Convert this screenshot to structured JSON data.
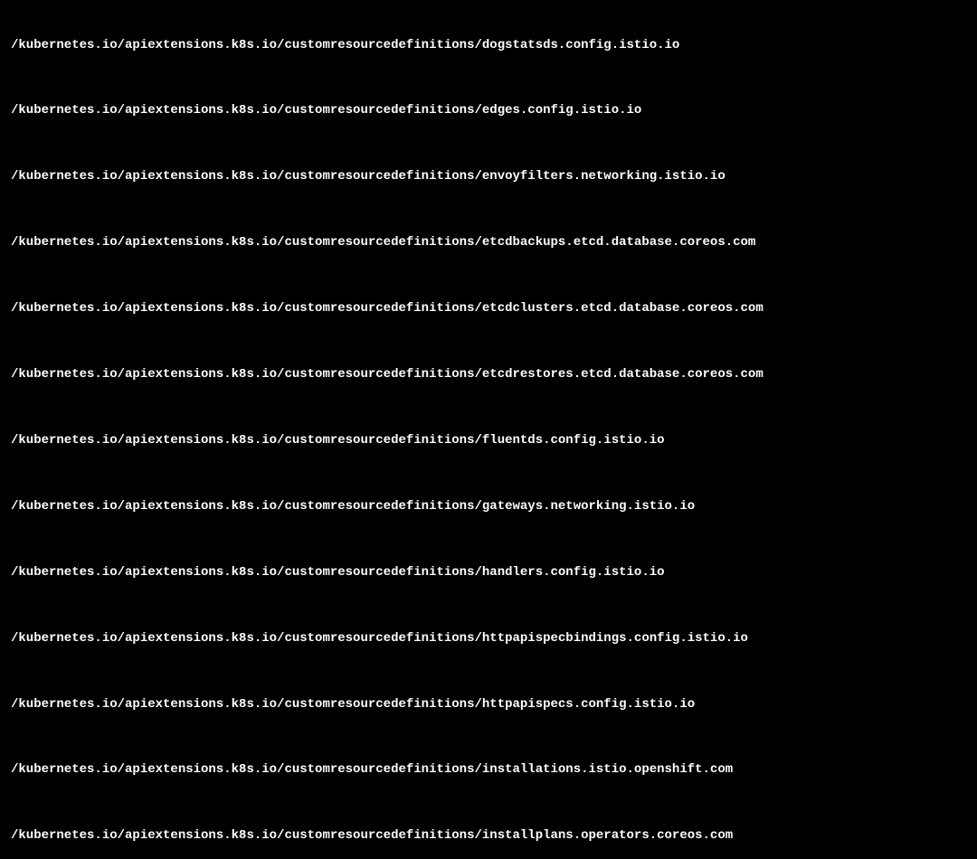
{
  "terminal": {
    "lines": [
      "/kubernetes.io/apiextensions.k8s.io/customresourcedefinitions/dogstatsds.config.istio.io",
      "/kubernetes.io/apiextensions.k8s.io/customresourcedefinitions/edges.config.istio.io",
      "/kubernetes.io/apiextensions.k8s.io/customresourcedefinitions/envoyfilters.networking.istio.io",
      "/kubernetes.io/apiextensions.k8s.io/customresourcedefinitions/etcdbackups.etcd.database.coreos.com",
      "/kubernetes.io/apiextensions.k8s.io/customresourcedefinitions/etcdclusters.etcd.database.coreos.com",
      "/kubernetes.io/apiextensions.k8s.io/customresourcedefinitions/etcdrestores.etcd.database.coreos.com",
      "/kubernetes.io/apiextensions.k8s.io/customresourcedefinitions/fluentds.config.istio.io",
      "/kubernetes.io/apiextensions.k8s.io/customresourcedefinitions/gateways.networking.istio.io",
      "/kubernetes.io/apiextensions.k8s.io/customresourcedefinitions/handlers.config.istio.io",
      "/kubernetes.io/apiextensions.k8s.io/customresourcedefinitions/httpapispecbindings.config.istio.io",
      "/kubernetes.io/apiextensions.k8s.io/customresourcedefinitions/httpapispecs.config.istio.io",
      "/kubernetes.io/apiextensions.k8s.io/customresourcedefinitions/installations.istio.openshift.com",
      "/kubernetes.io/apiextensions.k8s.io/customresourcedefinitions/installplans.operators.coreos.com"
    ]
  }
}
